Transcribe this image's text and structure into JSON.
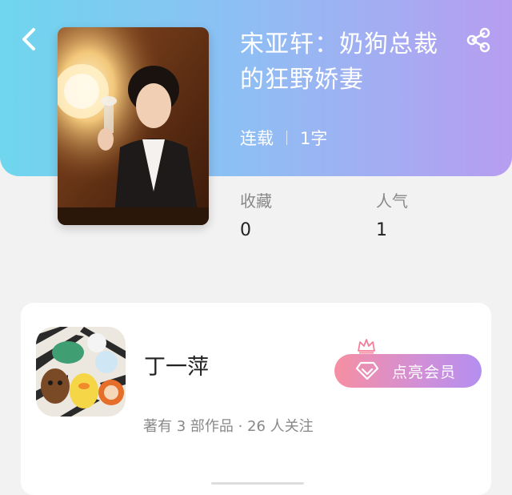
{
  "book": {
    "title": "宋亚轩：奶狗总裁的狂野娇妻",
    "status": "连载",
    "word_count": "1字"
  },
  "stats": {
    "favorites_label": "收藏",
    "favorites_value": "0",
    "popularity_label": "人气",
    "popularity_value": "1"
  },
  "author": {
    "name": "丁一萍",
    "info": "著有 3 部作品 · 26 人关注",
    "vip_button_label": "点亮会员"
  },
  "icons": {
    "back": "chevron-left-icon",
    "share": "share-icon",
    "crown": "crown-icon",
    "diamond": "diamond-icon"
  },
  "colors": {
    "header_gradient_start": "#6fd6ee",
    "header_gradient_end": "#b79df0",
    "vip_gradient_start": "#f68fa2",
    "vip_gradient_end": "#b48ff0"
  }
}
